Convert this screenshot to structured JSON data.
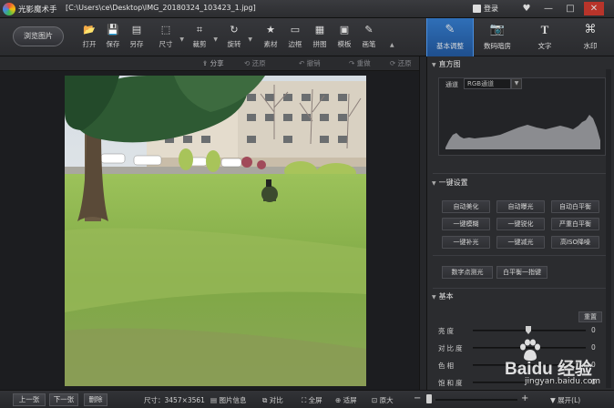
{
  "titlebar": {
    "app_name": "光影魔术手",
    "file_path": "[C:\\Users\\ce\\Desktop\\IMG_20180324_103423_1.jpg]",
    "login_label": "登录",
    "controls": [
      "♥",
      "—",
      "□",
      "✕"
    ]
  },
  "toolbar": {
    "browse_label": "浏览图片",
    "tools": [
      {
        "label": "打开",
        "icon": "📂"
      },
      {
        "label": "保存",
        "icon": "💾"
      },
      {
        "label": "另存",
        "icon": "▤"
      },
      {
        "label": "尺寸",
        "icon": "⬚"
      },
      {
        "label": "裁剪",
        "icon": "⌗"
      },
      {
        "label": "旋转",
        "icon": "↻"
      },
      {
        "label": "素材",
        "icon": "★"
      },
      {
        "label": "边框",
        "icon": "▭"
      },
      {
        "label": "拼图",
        "icon": "▦"
      },
      {
        "label": "模板",
        "icon": "▣"
      },
      {
        "label": "画笔",
        "icon": "✎"
      }
    ],
    "right_tabs": [
      {
        "label": "基本调整",
        "icon": "✎",
        "active": true
      },
      {
        "label": "数码暗房",
        "icon": "📷",
        "active": false
      },
      {
        "label": "文字",
        "icon": "T",
        "active": false
      },
      {
        "label": "水印",
        "icon": "⌘",
        "active": false
      }
    ]
  },
  "subbar": {
    "share": "分享",
    "restore": "还原",
    "undo": "撤销",
    "redo": "重做",
    "reset": "还原"
  },
  "right_panel": {
    "histogram_title": "直方图",
    "channel_label": "通道",
    "channel_value": "RGB通道",
    "oneclick_title": "一键设置",
    "oneclick_buttons": [
      "自动美化",
      "自动曝光",
      "自动白平衡",
      "一键模糊",
      "一键锐化",
      "严重白平衡",
      "一键补光",
      "一键减光",
      "高ISO降噪"
    ],
    "extra_buttons": [
      "数字点测光",
      "白平衡一指键"
    ],
    "basic_title": "基本",
    "reset_label": "重置",
    "sliders": [
      {
        "name": "亮度",
        "value": "0"
      },
      {
        "name": "对比度",
        "value": "0"
      },
      {
        "name": "色相",
        "value": "0"
      },
      {
        "name": "饱和度",
        "value": "0"
      }
    ]
  },
  "statusbar": {
    "prev": "上一张",
    "next": "下一张",
    "delete": "删除",
    "size": "尺寸：3457×3561",
    "info": "图片信息",
    "compare": "对比",
    "fullscreen": "全屏",
    "fit": "适屏",
    "original": "原大",
    "expand": "展开(L)"
  },
  "watermark": {
    "brand": "Baidu 经验",
    "url": "jingyan.baidu.com"
  }
}
